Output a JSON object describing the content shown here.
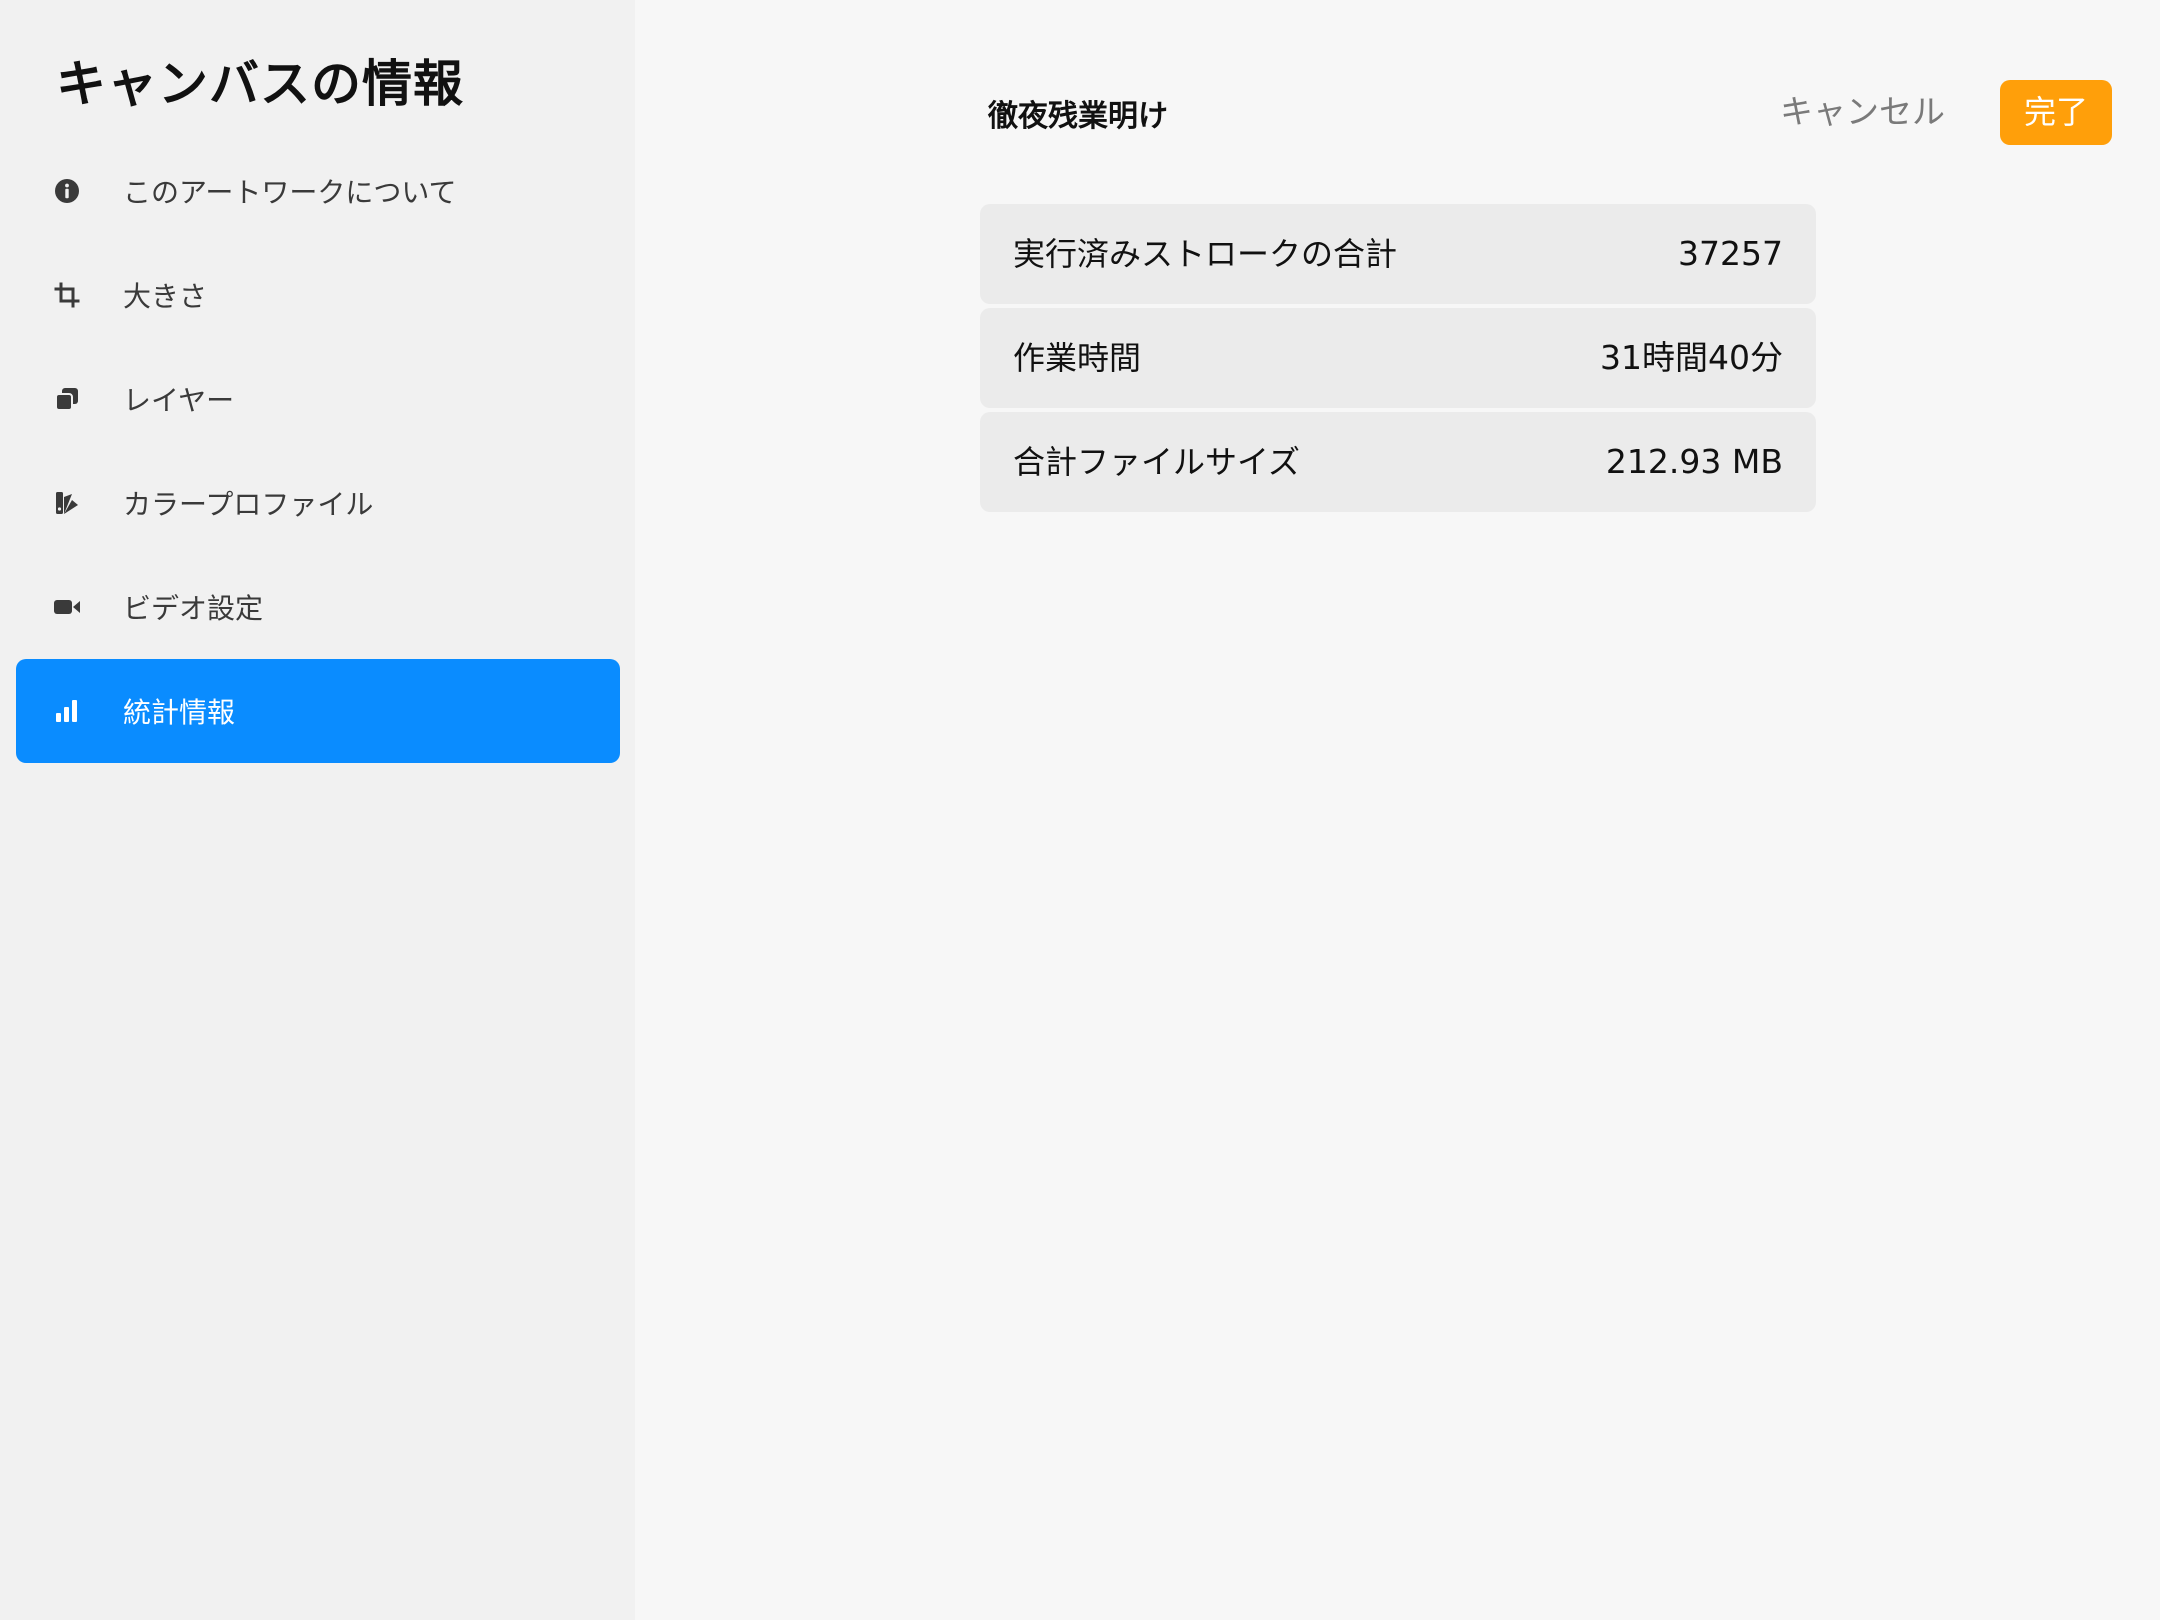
{
  "sidebar": {
    "title": "キャンバスの情報",
    "items": [
      {
        "label": "このアートワークについて",
        "icon": "info-icon",
        "active": false
      },
      {
        "label": "大きさ",
        "icon": "crop-icon",
        "active": false
      },
      {
        "label": "レイヤー",
        "icon": "layers-icon",
        "active": false
      },
      {
        "label": "カラープロファイル",
        "icon": "color-profile-icon",
        "active": false
      },
      {
        "label": "ビデオ設定",
        "icon": "video-camera-icon",
        "active": false
      },
      {
        "label": "統計情報",
        "icon": "bar-chart-icon",
        "active": true
      }
    ]
  },
  "header": {
    "title": "徹夜残業明け",
    "cancel_label": "キャンセル",
    "done_label": "完了"
  },
  "stats": [
    {
      "label": "実行済みストロークの合計",
      "value": "37257"
    },
    {
      "label": "作業時間",
      "value": "31時間40分"
    },
    {
      "label": "合計ファイルサイズ",
      "value": "212.93 MB"
    }
  ],
  "colors": {
    "accent_blue": "#0a8cff",
    "accent_orange": "#ff9f0a",
    "sidebar_bg": "#f1f1f1",
    "main_bg": "#f7f7f7",
    "row_bg": "#ebebeb"
  }
}
